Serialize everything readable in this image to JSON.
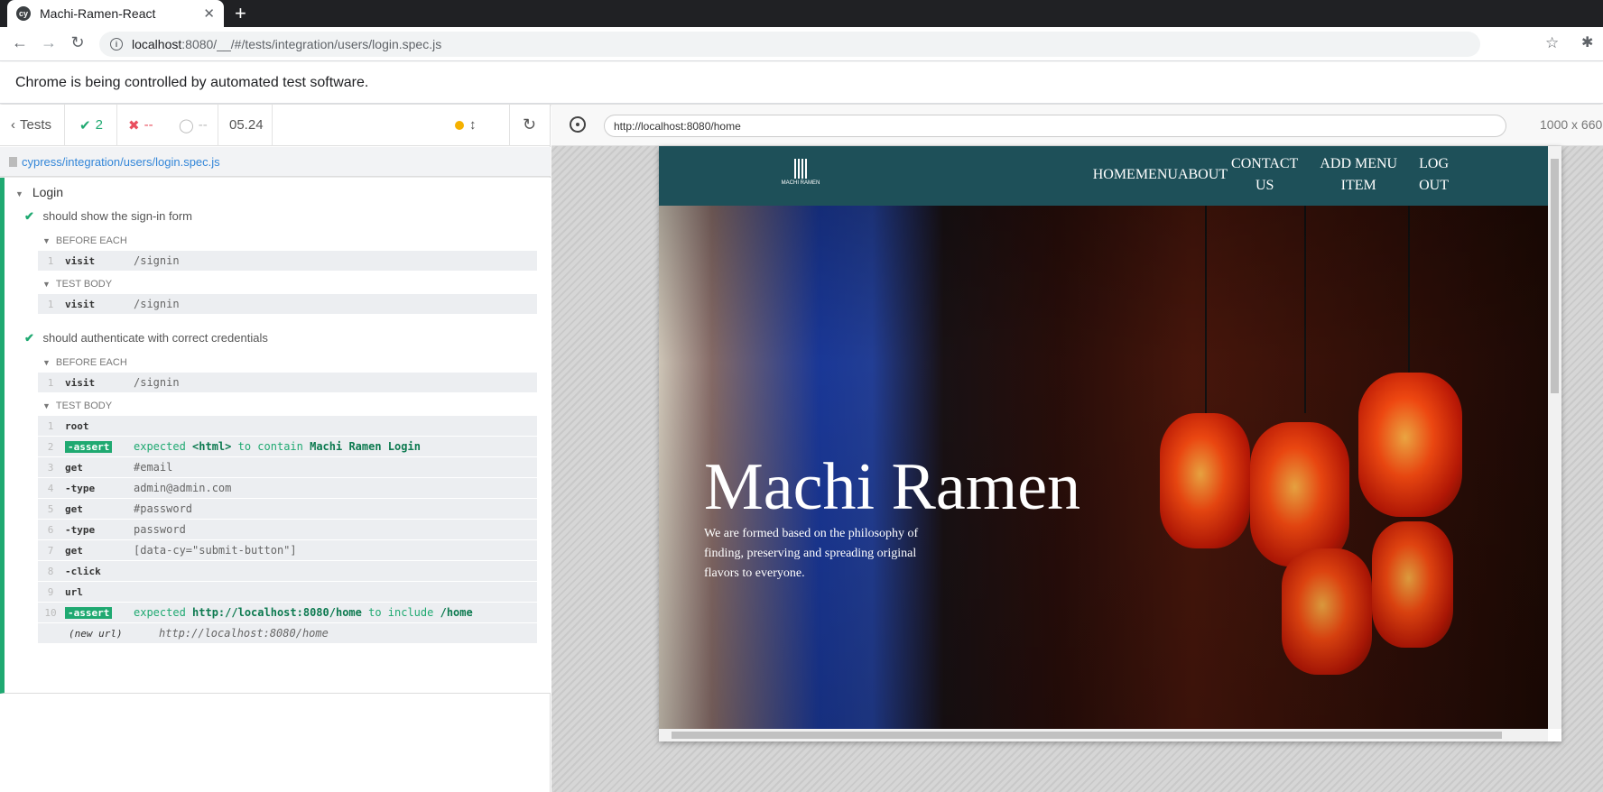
{
  "browser": {
    "tab_title": "Machi-Ramen-React",
    "tab_icon": "cy",
    "url_host": "localhost",
    "url_path": ":8080/__/#/tests/integration/users/login.spec.js",
    "infobar_text": "Chrome is being controlled by automated test software."
  },
  "reporter": {
    "tests_label": "Tests",
    "passed": "2",
    "failed": "--",
    "pending": "--",
    "duration": "05.24",
    "spec_path": "cypress/integration/users/login.spec.js",
    "suite": "Login",
    "tests": [
      {
        "title": "should show the sign-in form",
        "before_each_label": "BEFORE EACH",
        "before_each": [
          {
            "num": "1",
            "name": "visit",
            "msg": "/signin"
          }
        ],
        "body_label": "TEST BODY",
        "body": [
          {
            "num": "1",
            "name": "visit",
            "msg": "/signin"
          }
        ]
      },
      {
        "title": "should authenticate with correct credentials",
        "before_each_label": "BEFORE EACH",
        "before_each": [
          {
            "num": "1",
            "name": "visit",
            "msg": "/signin"
          }
        ],
        "body_label": "TEST BODY",
        "body": [
          {
            "num": "1",
            "name": "root",
            "msg": ""
          },
          {
            "num": "2",
            "name": "-assert",
            "msg_parts": [
              "expected",
              "<html>",
              "to contain",
              "Machi Ramen Login"
            ]
          },
          {
            "num": "3",
            "name": "get",
            "msg": "#email"
          },
          {
            "num": "4",
            "name": "-type",
            "msg": "admin@admin.com"
          },
          {
            "num": "5",
            "name": "get",
            "msg": "#password"
          },
          {
            "num": "6",
            "name": "-type",
            "msg": "password"
          },
          {
            "num": "7",
            "name": "get",
            "msg": "[data-cy=\"submit-button\"]"
          },
          {
            "num": "8",
            "name": "-click",
            "msg": ""
          },
          {
            "num": "9",
            "name": "url",
            "msg": ""
          },
          {
            "num": "10",
            "name": "-assert",
            "msg_parts": [
              "expected",
              "http://localhost:8080/home",
              "to include",
              "/home"
            ]
          },
          {
            "num": "",
            "name": "(new url)",
            "msg": "http://localhost:8080/home"
          }
        ]
      }
    ]
  },
  "aut": {
    "url": "http://localhost:8080/home",
    "viewport": "1000 x 660",
    "logo_text": "MACHI RAMEN",
    "nav": [
      "HOME",
      "MENU",
      "ABOUT",
      "CONTACT\nUS",
      "ADD MENU\nITEM",
      "LOG\nOUT"
    ],
    "hero_title": "Machi Ramen",
    "hero_subtitle": "We are formed based on the philosophy of finding, preserving and spreading original flavors to everyone."
  },
  "colors": {
    "pass": "#1fa971",
    "fail": "#e94f5f",
    "site_nav": "#1e5059"
  }
}
